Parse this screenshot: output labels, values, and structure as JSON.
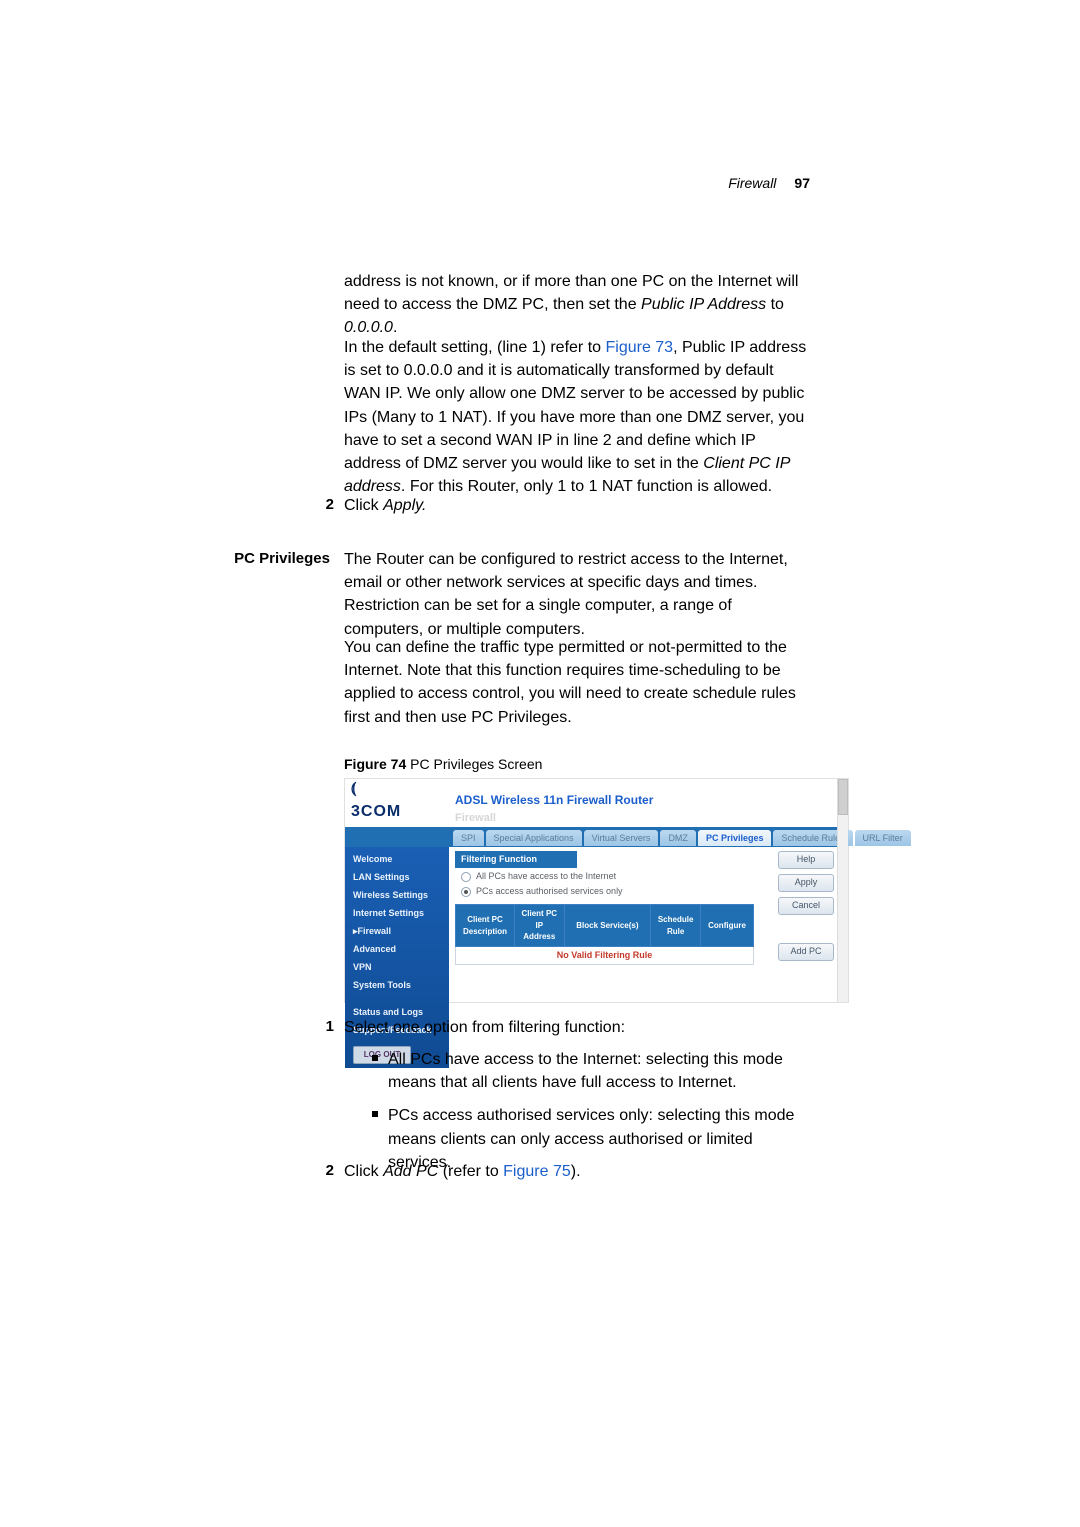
{
  "runhead": {
    "section": "Firewall",
    "page": "97"
  },
  "para1a": "address is not known, or if more than one PC on the Internet will need to access the DMZ PC, then set the ",
  "para1b_i": "Public IP Address",
  "para1c": " to ",
  "para1d_i": "0.0.0.0",
  "para1e": ".",
  "para2a": "In the default setting, (line 1) refer to ",
  "para2_link": "Figure 73",
  "para2b": ", Public IP address is set to 0.0.0.0 and it is automatically transformed by default WAN IP. We only allow one DMZ server to be accessed by public IPs (Many to 1 NAT). If you have more than one DMZ server, you have to set a second WAN IP in line 2 and define which IP address of DMZ server you would like to set in the ",
  "para2c_i": "Client PC IP address",
  "para2d": ". For this Router, only 1 to 1 NAT function is allowed.",
  "step2_num": "2",
  "step2a": "Click ",
  "step2b_i": "Apply.",
  "sidehead": "PC Privileges",
  "pp_p1": "The Router can be configured to restrict access to the Internet, email or other network services at specific days and times. Restriction can be set for a single computer, a range of computers, or multiple computers.",
  "pp_p2": "You can define the traffic type permitted or not-permitted to the Internet. Note that this function requires time-scheduling to be applied to access control, you will need to create schedule rules first and then use PC Privileges.",
  "fig74_bold": "Figure 74",
  "fig74_rest": "   PC Privileges Screen",
  "router": {
    "product": "ADSL Wireless 11n Firewall Router",
    "section": "Firewall",
    "logo_line2": "3COM",
    "tabs": [
      "SPI",
      "Special Applications",
      "Virtual Servers",
      "DMZ",
      "PC Privileges",
      "Schedule Rules",
      "URL Filter"
    ],
    "selected_tab": "PC Privileges",
    "panel_head": "Filtering Function",
    "radio1": "All PCs have access to the Internet",
    "radio2": "PCs access authorised services only",
    "cols": [
      "Client PC Description",
      "Client PC IP Address",
      "Block Service(s)",
      "Schedule Rule",
      "Configure"
    ],
    "no_rule": "No Valid Filtering Rule",
    "btn_help": "Help",
    "btn_apply": "Apply",
    "btn_cancel": "Cancel",
    "btn_addpc": "Add PC",
    "logout": "LOG OUT",
    "sidebar": {
      "welcome": "Welcome",
      "lan": "LAN Settings",
      "wireless": "Wireless Settings",
      "inet": "Internet Settings",
      "fw": "Firewall",
      "adv": "Advanced",
      "vpn": "VPN",
      "tools": "System Tools",
      "status": "Status and Logs",
      "support": "Support/Feedback"
    }
  },
  "s1_num": "1",
  "s1_text": "Select one option from filtering function:",
  "b1": "All PCs have access to the Internet: selecting this mode means that all clients have full access to Internet.",
  "b2": "PCs access authorised services only: selecting this mode means clients can only access authorised or limited services.",
  "s2_num": "2",
  "s2a": "Click ",
  "s2b_i": "Add PC",
  "s2c": " (refer to ",
  "s2_link": "Figure 75",
  "s2d": ")."
}
